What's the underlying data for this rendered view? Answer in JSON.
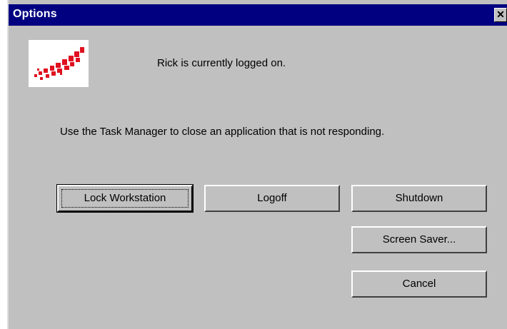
{
  "window": {
    "title": "Options",
    "close_glyph": "✕"
  },
  "logo": {
    "icon": "windows-nt-logo",
    "color": "#e01020"
  },
  "message": {
    "logged_on": "Rick is currently logged on.",
    "info": "Use the Task Manager to close an application that is not responding."
  },
  "buttons": {
    "lock": "Lock Workstation",
    "logoff": "Logoff",
    "shutdown": "Shutdown",
    "screen_saver": "Screen Saver...",
    "cancel": "Cancel"
  }
}
